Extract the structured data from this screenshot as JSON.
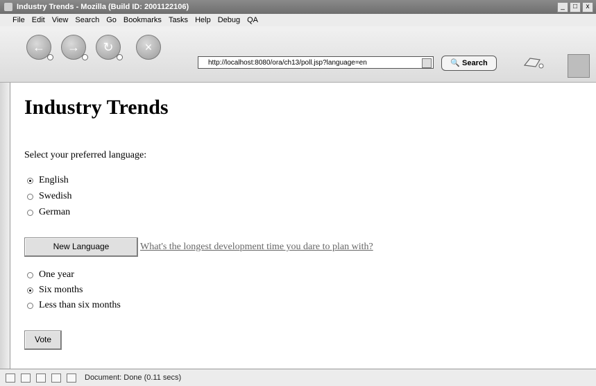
{
  "window": {
    "title": "Industry Trends - Mozilla (Build ID: 2001122106)",
    "controls": [
      "_",
      "□",
      "x"
    ]
  },
  "menu": [
    "File",
    "Edit",
    "View",
    "Search",
    "Go",
    "Bookmarks",
    "Tasks",
    "Help",
    "Debug",
    "QA"
  ],
  "toolbar": {
    "url": "http://localhost:8080/ora/ch13/poll.jsp?language=en",
    "search_label": "Search"
  },
  "page": {
    "heading": "Industry Trends",
    "prompt": "Select your preferred language:",
    "languages": [
      {
        "label": "English",
        "checked": true
      },
      {
        "label": "Swedish",
        "checked": false
      },
      {
        "label": "German",
        "checked": false
      }
    ],
    "new_language_button": "New Language",
    "question": "What's the longest development time you dare to plan with?",
    "answers": [
      {
        "label": "One year",
        "checked": false
      },
      {
        "label": "Six months",
        "checked": true
      },
      {
        "label": "Less than six months",
        "checked": false
      }
    ],
    "vote_button": "Vote"
  },
  "status": {
    "text": "Document: Done (0.11 secs)"
  }
}
